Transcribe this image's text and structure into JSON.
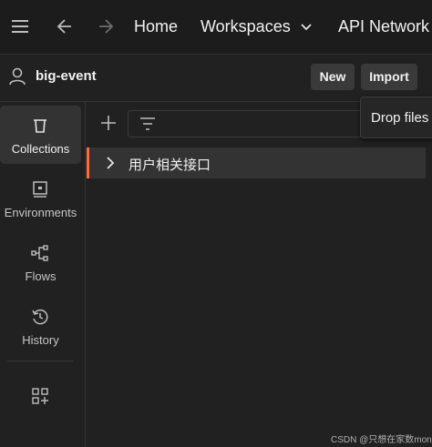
{
  "nav": {
    "home": "Home",
    "workspaces": "Workspaces",
    "api_network": "API Network"
  },
  "workspace": {
    "name": "big-event",
    "new_label": "New",
    "import_label": "Import"
  },
  "import_dropdown": {
    "text": "Drop files"
  },
  "sidebar": {
    "items": [
      {
        "label": "Collections",
        "icon": "trash-can-icon"
      },
      {
        "label": "Environments",
        "icon": "environment-icon"
      },
      {
        "label": "Flows",
        "icon": "flows-icon"
      },
      {
        "label": "History",
        "icon": "history-icon"
      }
    ]
  },
  "collections": [
    {
      "name": "用户相关接口"
    }
  ],
  "watermark": "CSDN @只想在家数money",
  "colors": {
    "accent": "#ff6c37",
    "background": "#212121"
  }
}
